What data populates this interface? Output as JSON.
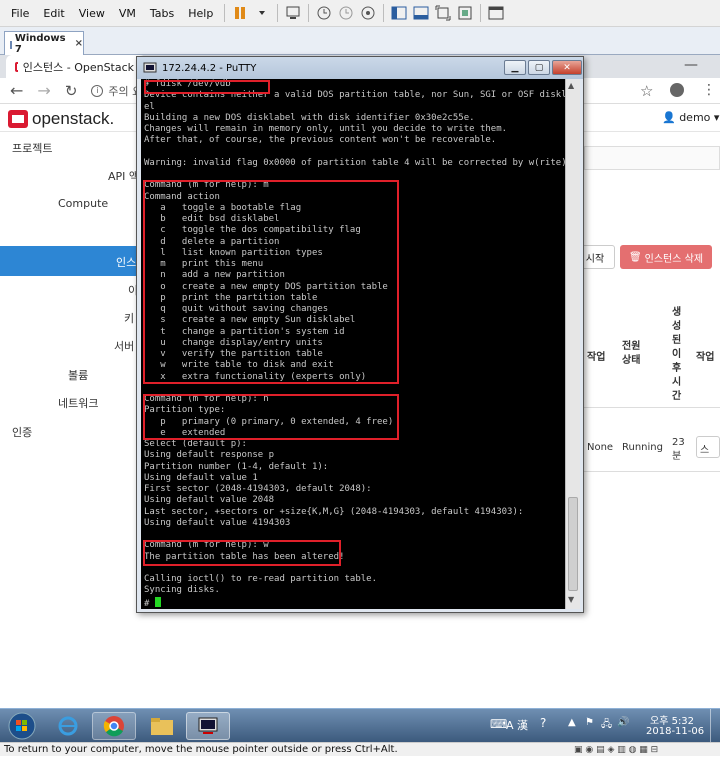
{
  "vmware": {
    "menu": [
      "File",
      "Edit",
      "View",
      "VM",
      "Tabs",
      "Help"
    ],
    "tab_label": "Windows 7",
    "status_text": "To return to your computer, move the mouse pointer outside or press Ctrl+Alt."
  },
  "browser": {
    "tab_title": "인스턴스 - OpenStack D",
    "address_prefix": "주의 요"
  },
  "openstack": {
    "logo_text": "openstack.",
    "user": "demo",
    "sidebar": {
      "project": "프로젝트",
      "api": "API 액",
      "compute": "Compute",
      "instances": "인스",
      "images": "이",
      "keys": "키",
      "server_groups": "서버",
      "volume": "볼륨",
      "network": "네트워크",
      "identity": "인증"
    },
    "btn_start": "시작",
    "btn_delete": "인스턴스 삭제",
    "col_task": "작업",
    "col_power": "전원 상태",
    "col_age": "생성된 이후 시간",
    "col_actions": "작업",
    "row_task": "None",
    "row_power": "Running",
    "row_age": "23 분",
    "row_action": "스냅"
  },
  "putty": {
    "title": "172.24.4.2 - PuTTY",
    "lines": [
      "# fdisk /dev/vdb",
      "Device contains neither a valid DOS partition table, nor Sun, SGI or OSF disklab",
      "el",
      "Building a new DOS disklabel with disk identifier 0x30e2c55e.",
      "Changes will remain in memory only, until you decide to write them.",
      "After that, of course, the previous content won't be recoverable.",
      "",
      "Warning: invalid flag 0x0000 of partition table 4 will be corrected by w(rite)",
      "",
      "Command (m for help): m",
      "Command action",
      "   a   toggle a bootable flag",
      "   b   edit bsd disklabel",
      "   c   toggle the dos compatibility flag",
      "   d   delete a partition",
      "   l   list known partition types",
      "   m   print this menu",
      "   n   add a new partition",
      "   o   create a new empty DOS partition table",
      "   p   print the partition table",
      "   q   quit without saving changes",
      "   s   create a new empty Sun disklabel",
      "   t   change a partition's system id",
      "   u   change display/entry units",
      "   v   verify the partition table",
      "   w   write table to disk and exit",
      "   x   extra functionality (experts only)",
      "",
      "Command (m for help): n",
      "Partition type:",
      "   p   primary (0 primary, 0 extended, 4 free)",
      "   e   extended",
      "Select (default p):",
      "Using default response p",
      "Partition number (1-4, default 1):",
      "Using default value 1",
      "First sector (2048-4194303, default 2048):",
      "Using default value 2048",
      "Last sector, +sectors or +size{K,M,G} (2048-4194303, default 4194303):",
      "Using default value 4194303",
      "",
      "Command (m for help): w",
      "The partition table has been altered!",
      "",
      "Calling ioctl() to re-read partition table.",
      "Syncing disks.",
      "# "
    ]
  },
  "taskbar": {
    "time": "오후 5:32",
    "date": "2018-11-06",
    "ime": "A 漢"
  }
}
